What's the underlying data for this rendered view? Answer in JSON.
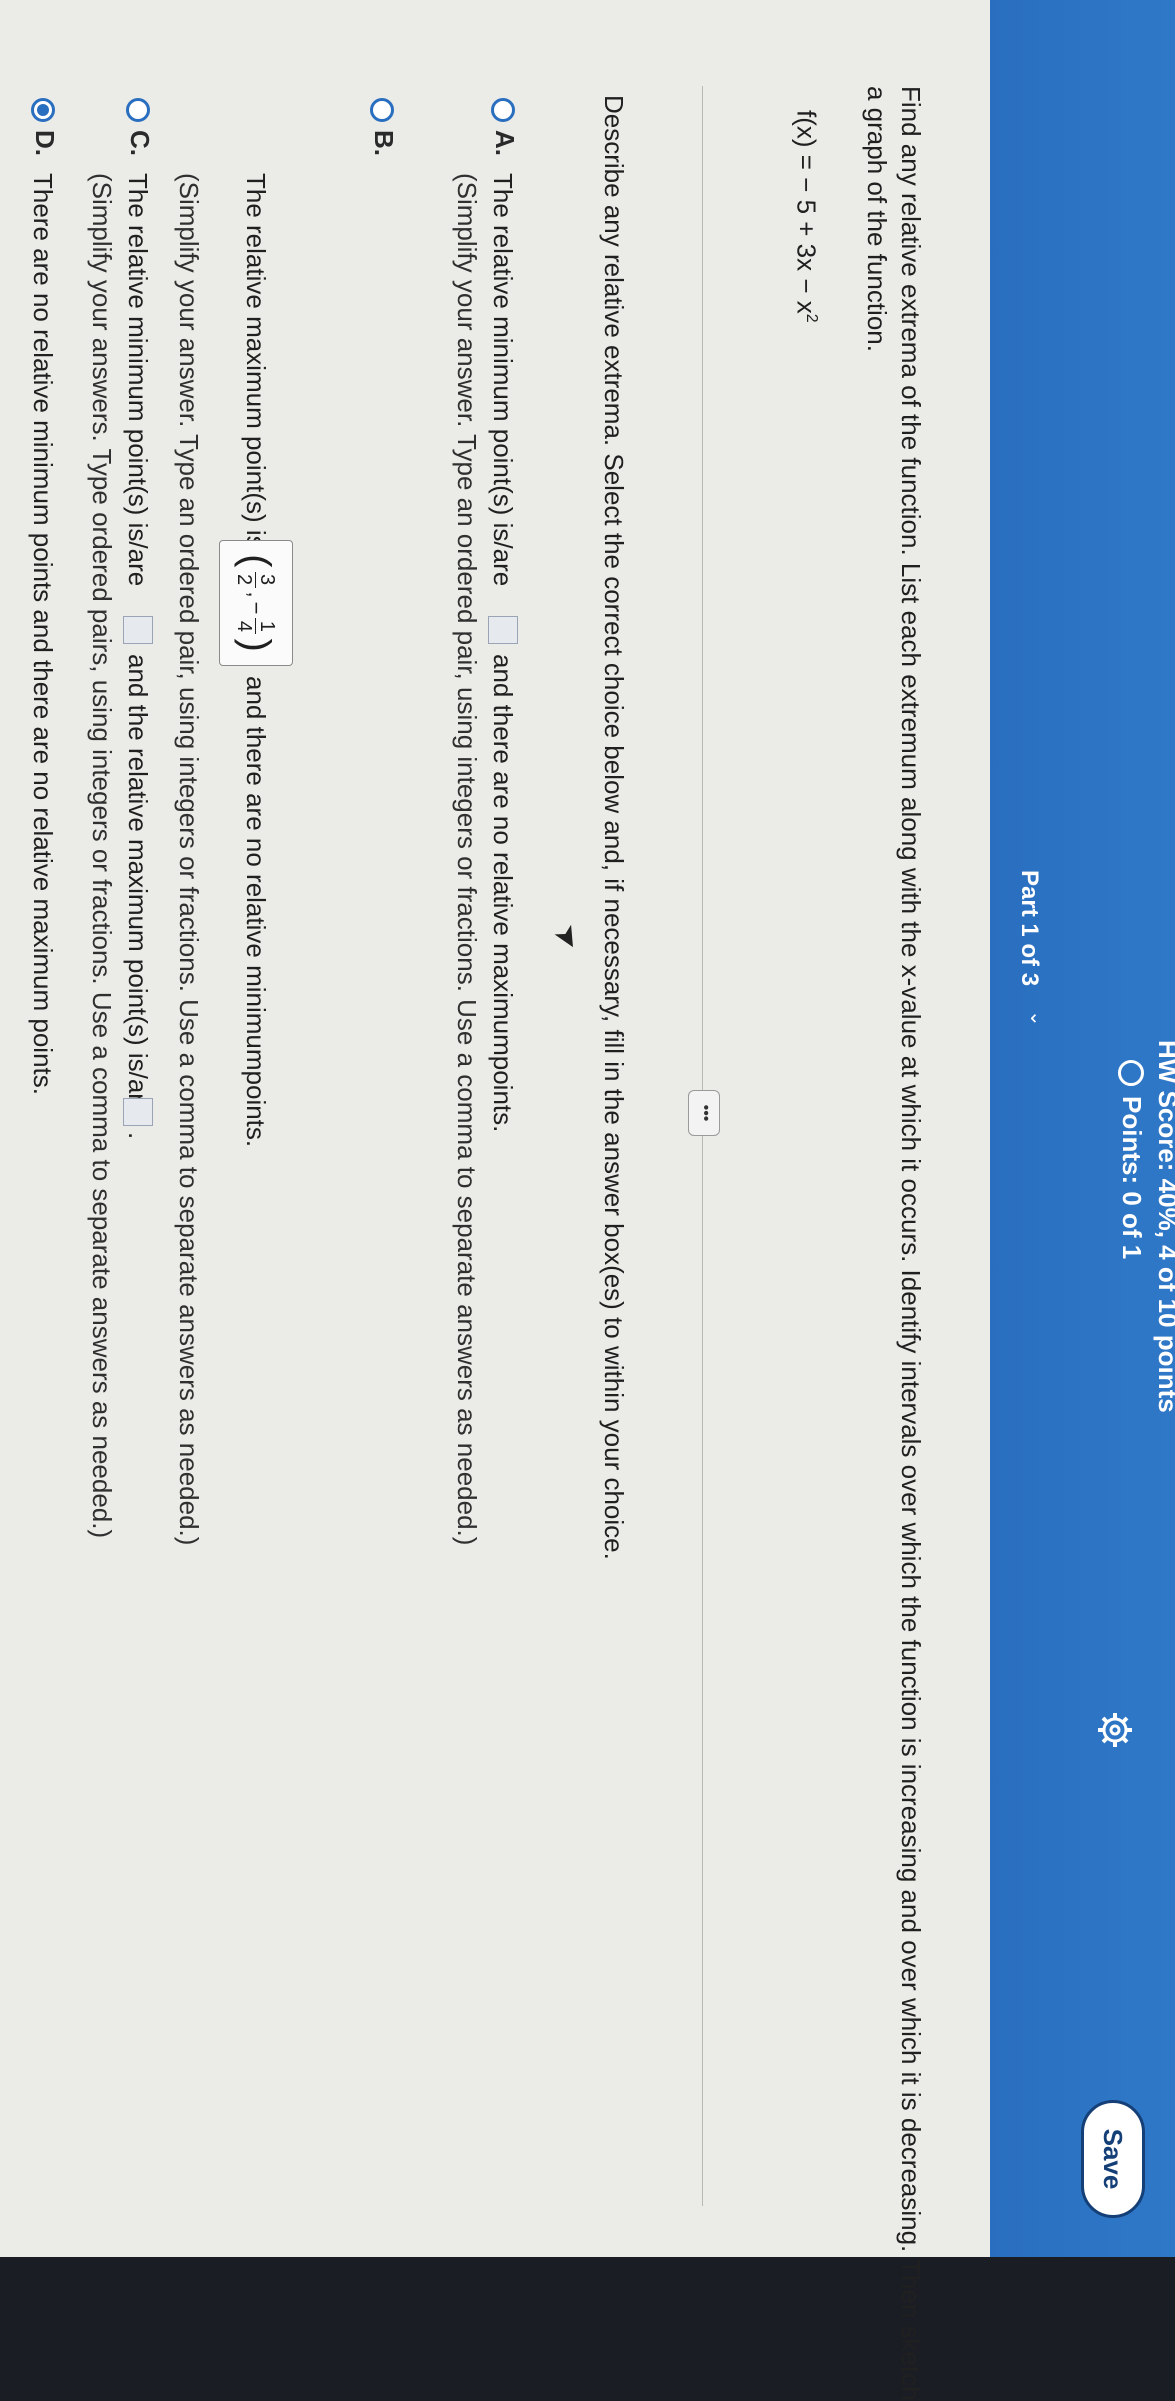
{
  "header": {
    "hw_score": "HW Score: 40%, 4 of 10 points",
    "points": "Points: 0 of 1",
    "save_label": "Save",
    "part_label": "Part 1 of 3"
  },
  "question": {
    "line1": "Find any relative extrema of the function. List each extremum along with the x-value at which it occurs. Identify intervals over which the function is increasing and over which it is decreasing. Then sketch",
    "line2": "a graph of the function.",
    "function_base": "f(x) = − 5 + 3x − x",
    "function_exp": "2"
  },
  "more_button": "•••",
  "instruction": "Describe any relative extrema. Select the correct choice below and, if necessary, fill in the answer box(es) to within your choice.",
  "options": {
    "a": {
      "letter": "A.",
      "text_before": "The relative minimum point(s) is/are",
      "text_after": "and there are no relative maximumpoints.",
      "hint": "(Simplify your answer. Type an ordered pair, using integers or fractions. Use a comma to separate answers as needed.)"
    },
    "b": {
      "letter": "B.",
      "text_before": "The relative maximum point(s) is/are",
      "text_after": "and there are no relative minimumpoints.",
      "hint": "(Simplify your answer. Type an ordered pair, using integers or fractions. Use a comma to separate answers as needed.)",
      "answer_num1": "3",
      "answer_den1": "2",
      "answer_num2": "1",
      "answer_den2": "4",
      "answer_comma": ",",
      "answer_minus": "−"
    },
    "c": {
      "letter": "C.",
      "text_before": "The relative minimum point(s) is/are",
      "text_mid": "and the relative maximum point(s) is/are",
      "text_end": ".",
      "hint": "(Simplify your answers. Type ordered pairs, using integers or fractions. Use a comma to separate answers as needed.)"
    },
    "d": {
      "letter": "D.",
      "text": "There are no relative minimum points and there are no relative maximum points.",
      "selected": true
    }
  }
}
